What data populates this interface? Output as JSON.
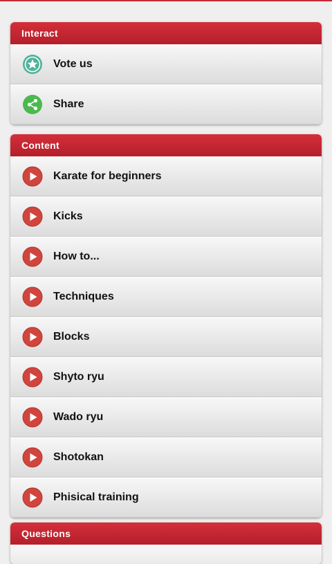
{
  "colors": {
    "accent_red": "#c62a34",
    "play_red": "#d0453d",
    "vote_teal": "#4fb39a",
    "share_green": "#4cb94e"
  },
  "sections": {
    "interact": {
      "title": "Interact",
      "items": [
        {
          "label": "Vote us",
          "icon": "star-badge-icon"
        },
        {
          "label": "Share",
          "icon": "share-icon"
        }
      ]
    },
    "content": {
      "title": "Content",
      "items": [
        {
          "label": "Karate for beginners",
          "icon": "play-icon"
        },
        {
          "label": "Kicks",
          "icon": "play-icon"
        },
        {
          "label": "How to...",
          "icon": "play-icon"
        },
        {
          "label": "Techniques",
          "icon": "play-icon"
        },
        {
          "label": "Blocks",
          "icon": "play-icon"
        },
        {
          "label": "Shyto ryu",
          "icon": "play-icon"
        },
        {
          "label": "Wado ryu",
          "icon": "play-icon"
        },
        {
          "label": "Shotokan",
          "icon": "play-icon"
        },
        {
          "label": "Phisical training",
          "icon": "play-icon"
        }
      ]
    },
    "questions": {
      "title": "Questions"
    }
  }
}
